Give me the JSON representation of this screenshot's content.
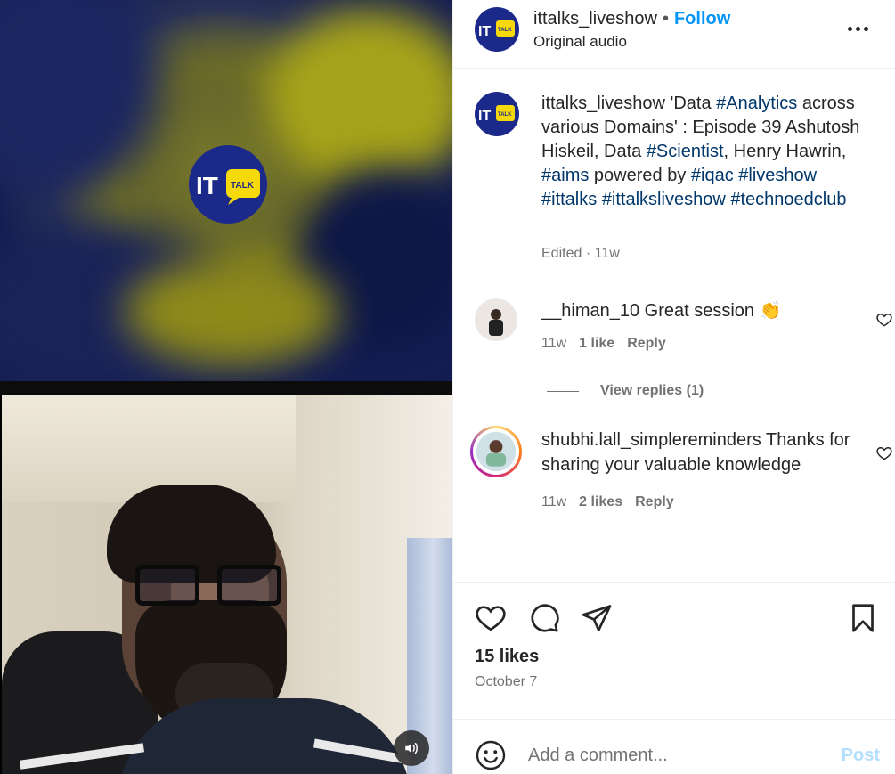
{
  "header": {
    "username": "ittalks_liveshow",
    "separator": "•",
    "follow_label": "Follow",
    "audio": "Original audio",
    "logo_text": "IT",
    "logo_badge": "TALK"
  },
  "caption": {
    "username": "ittalks_liveshow",
    "parts": [
      {
        "t": " 'Data ",
        "tag": false
      },
      {
        "t": "#Analytics",
        "tag": true
      },
      {
        "t": " across various Domains' : Episode 39 Ashutosh Hiskeil, Data ",
        "tag": false
      },
      {
        "t": "#Scientist",
        "tag": true
      },
      {
        "t": ", Henry Hawrin, ",
        "tag": false
      },
      {
        "t": "#aims",
        "tag": true
      },
      {
        "t": " powered by ",
        "tag": false
      },
      {
        "t": "#iqac",
        "tag": true
      },
      {
        "t": " ",
        "tag": false
      },
      {
        "t": "#liveshow",
        "tag": true
      },
      {
        "t": " ",
        "tag": false
      },
      {
        "t": "#ittalks",
        "tag": true
      },
      {
        "t": " ",
        "tag": false
      },
      {
        "t": "#ittalksliveshow",
        "tag": true
      },
      {
        "t": " ",
        "tag": false
      },
      {
        "t": "#technoedclub",
        "tag": true
      }
    ],
    "edited": "Edited",
    "meta_sep": "·",
    "time": "11w"
  },
  "comments": [
    {
      "username": "__himan_10",
      "text": "Great session 👏",
      "time": "11w",
      "likes": "1 like",
      "reply": "Reply",
      "view_replies": "View replies (1)"
    },
    {
      "username": "shubhi.lall_simplereminders",
      "text": "Thanks for sharing your valuable knowledge",
      "time": "11w",
      "likes": "2 likes",
      "reply": "Reply"
    }
  ],
  "stats": {
    "likes": "15 likes",
    "date": "October 7"
  },
  "composer": {
    "placeholder": "Add a comment...",
    "post_label": "Post"
  },
  "colors": {
    "accent": "#0095f6",
    "hashtag": "#00376b",
    "muted": "#737373",
    "post_disabled": "#b2dffc"
  }
}
